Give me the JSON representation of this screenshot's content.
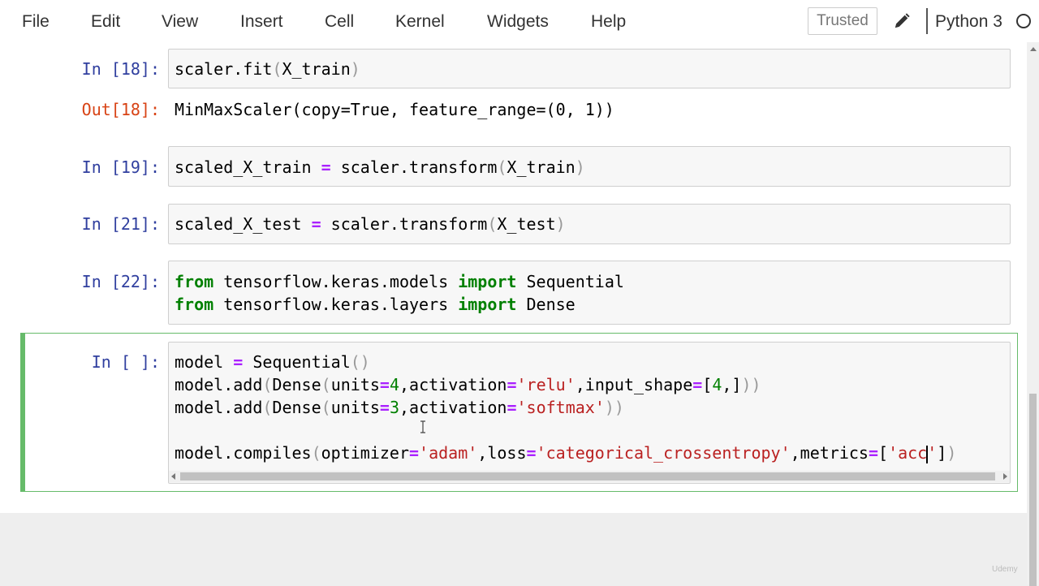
{
  "menubar": {
    "items": [
      "File",
      "Edit",
      "View",
      "Insert",
      "Cell",
      "Kernel",
      "Widgets",
      "Help"
    ],
    "trusted_label": "Trusted",
    "kernel_name": "Python 3"
  },
  "cells": [
    {
      "prompt": "In [18]:",
      "code": "scaler.fit(X_train)",
      "output_prompt": "Out[18]:",
      "output": "MinMaxScaler(copy=True, feature_range=(0, 1))"
    },
    {
      "prompt": "In [19]:",
      "code": "scaled_X_train = scaler.transform(X_train)"
    },
    {
      "prompt": "In [21]:",
      "code": "scaled_X_test = scaler.transform(X_test)"
    },
    {
      "prompt": "In [22]:",
      "code": "from tensorflow.keras.models import Sequential\nfrom tensorflow.keras.layers import Dense"
    },
    {
      "prompt": "In [ ]:",
      "code": "model = Sequential()\nmodel.add(Dense(units=4,activation='relu',input_shape=[4,]))\nmodel.add(Dense(units=3,activation='softmax'))\n\nmodel.compiles(optimizer='adam',loss='categorical_crossentropy',metrics=['acc'])"
    }
  ],
  "watermark": "Udemy",
  "colors": {
    "prompt_in": "#303f9f",
    "prompt_out": "#d84315",
    "selected_border": "#66bb6a",
    "keyword": "#008000",
    "string": "#ba2121",
    "operator": "#aa22ff"
  },
  "icons": [
    "pencil-icon",
    "kernel-idle-icon",
    "mouse-cursor-icon"
  ]
}
